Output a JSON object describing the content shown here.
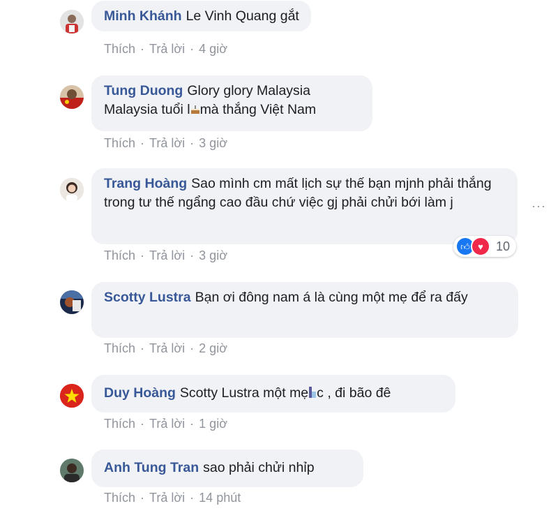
{
  "comments": [
    {
      "author": "Minh Khánh",
      "text": "Le Vinh Quang gắt",
      "actions": {
        "like": "Thích",
        "reply": "Trả lời",
        "time": "4 giờ"
      }
    },
    {
      "author": "Tung Duong",
      "text_part1": "Glory glory Malaysia",
      "text_part2": "Malaysia tuổi l",
      "text_part3": "mà thắng Việt Nam",
      "actions": {
        "like": "Thích",
        "reply": "Trả lời",
        "time": "3 giờ"
      }
    },
    {
      "author": "Trang Hoàng",
      "text": "Sao mình cm mất lịch sự thế bạn mjnh phải thắng trong tư thế ngẩng cao đầu chứ việc gj phải chửi bới làm j",
      "actions": {
        "like": "Thích",
        "reply": "Trả lời",
        "time": "3 giờ"
      },
      "reactions": {
        "count": "10",
        "icons": [
          "like-icon",
          "love-icon"
        ]
      }
    },
    {
      "author": "Scotty Lustra",
      "text": "Bạn ơi đông nam á là cùng một mẹ để ra đấy",
      "actions": {
        "like": "Thích",
        "reply": "Trả lời",
        "time": "2 giờ"
      }
    },
    {
      "author": "Duy Hoàng",
      "text_part1": "Scotty Lustra một mẹ",
      "text_part2": "c , đi bão đê",
      "actions": {
        "like": "Thích",
        "reply": "Trả lời",
        "time": "1 giờ"
      }
    },
    {
      "author": "Anh Tung Tran",
      "text": "sao phải chửi nhỉp",
      "actions": {
        "like": "Thích",
        "reply": "Trả lời",
        "time": "14 phút"
      }
    }
  ],
  "more_options": "···",
  "colors": {
    "author": "#385898",
    "bubble": "#f0f2f5",
    "meta": "#90949c"
  }
}
